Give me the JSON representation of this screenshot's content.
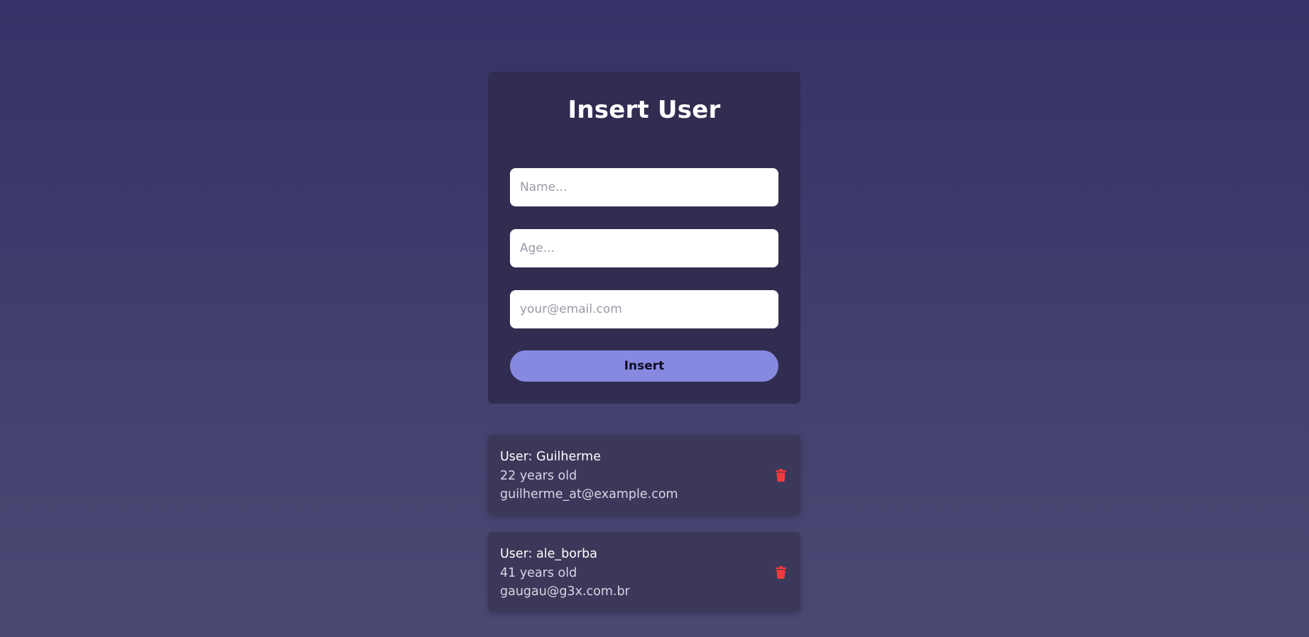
{
  "form": {
    "title": "Insert User",
    "name_placeholder": "Name...",
    "age_placeholder": "Age...",
    "email_placeholder": "your@email.com",
    "submit_label": "Insert"
  },
  "users": [
    {
      "name_line": "User: Guilherme",
      "age_line": "22 years old",
      "email": "guilherme_at@example.com",
      "delete_icon": "trash-icon"
    },
    {
      "name_line": "User: ale_borba",
      "age_line": "41 years old",
      "email": "gaugau@g3x.com.br",
      "delete_icon": "trash-icon"
    }
  ],
  "colors": {
    "background_top": "#353267",
    "background_bottom": "#4b4873",
    "card": "#302d50",
    "user_card": "#3b3859",
    "button": "#8789e0",
    "delete": "#ee3b3b"
  }
}
